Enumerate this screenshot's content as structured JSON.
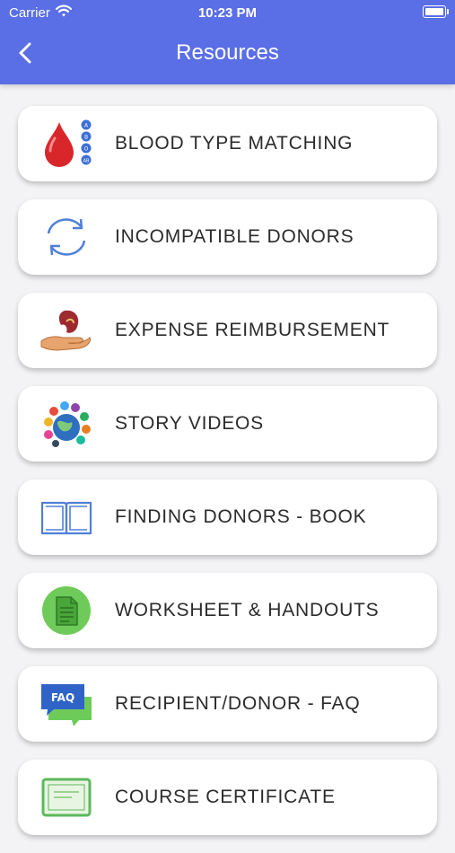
{
  "status_bar": {
    "carrier": "Carrier",
    "time": "10:23 PM"
  },
  "header": {
    "title": "Resources",
    "color": "#5a6ee6"
  },
  "resources": [
    {
      "label": "BLOOD TYPE MATCHING",
      "icon": "blood-drop-icon"
    },
    {
      "label": "INCOMPATIBLE DONORS",
      "icon": "sync-arrows-icon"
    },
    {
      "label": "EXPENSE REIMBURSEMENT",
      "icon": "kidney-hand-icon"
    },
    {
      "label": "STORY VIDEOS",
      "icon": "globe-apps-icon"
    },
    {
      "label": "FINDING DONORS - BOOK",
      "icon": "open-book-icon"
    },
    {
      "label": "WORKSHEET & HANDOUTS",
      "icon": "document-icon"
    },
    {
      "label": "RECIPIENT/DONOR - FAQ",
      "icon": "faq-bubble-icon"
    },
    {
      "label": "COURSE CERTIFICATE",
      "icon": "certificate-icon"
    }
  ],
  "blood_type_badges": [
    "A",
    "B",
    "O",
    "AB"
  ],
  "faq_badge": "FAQ"
}
